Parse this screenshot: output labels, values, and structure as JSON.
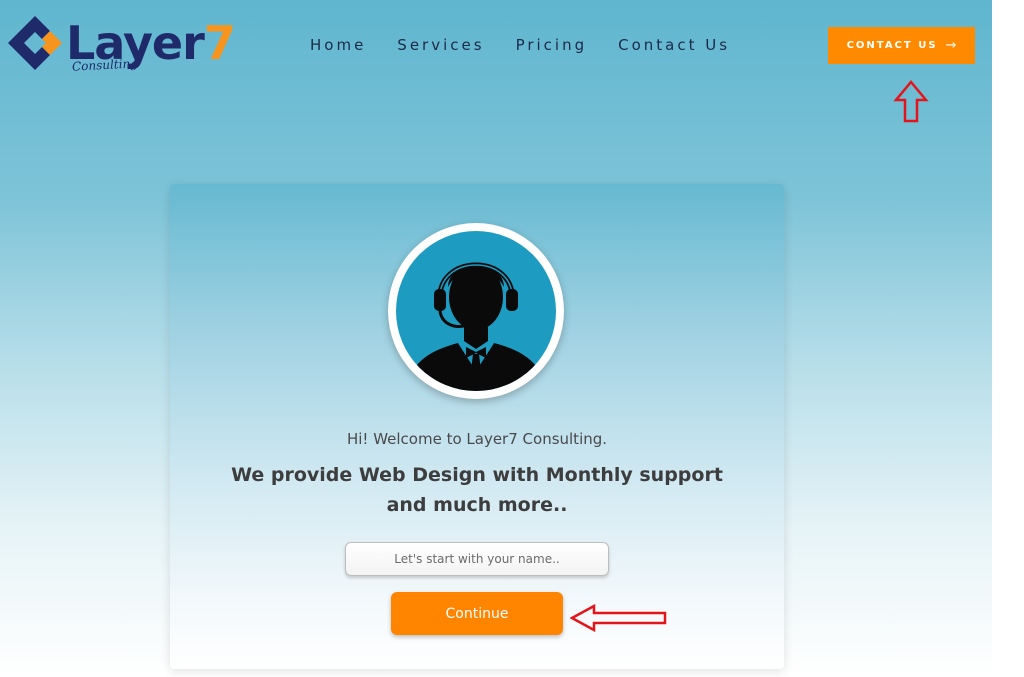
{
  "brand": {
    "name": "Layer",
    "name_suffix": "7",
    "tagline": "Consulting",
    "colors": {
      "navy": "#1f2a6b",
      "orange": "#f7941d"
    }
  },
  "nav": {
    "items": [
      {
        "label": "Home"
      },
      {
        "label": "Services"
      },
      {
        "label": "Pricing"
      },
      {
        "label": "Contact Us"
      }
    ],
    "cta_label": "CONTACT US",
    "cta_icon": "arrow-right-icon"
  },
  "annotations": {
    "up_arrow": "up-arrow-icon",
    "left_arrow": "left-arrow-icon",
    "color": "#e3151a"
  },
  "card": {
    "avatar_icon": "support-agent-headset-icon",
    "welcome": "Hi! Welcome to Layer7 Consulting.",
    "headline": "We provide Web Design with Monthly support and much more..",
    "name_placeholder": "Let's start with your name..",
    "name_value": "",
    "continue_label": "Continue"
  },
  "theme": {
    "accent": "#ff8400",
    "background_top": "#5fb6cf"
  }
}
